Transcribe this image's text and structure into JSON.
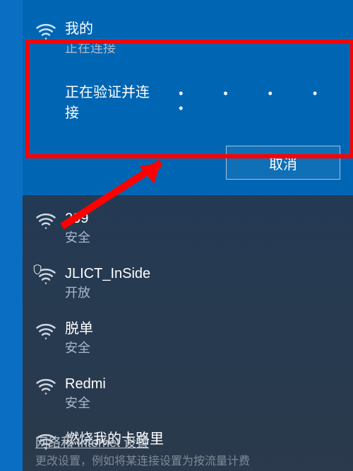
{
  "connecting": {
    "name": "我的",
    "sub": "正在连接",
    "status": "正在验证并连接",
    "cancel": "取消"
  },
  "networks": [
    {
      "name": "209",
      "sub": "安全",
      "shield": false
    },
    {
      "name": "JLICT_InSide",
      "sub": "开放",
      "shield": true
    },
    {
      "name": "脱单",
      "sub": "安全",
      "shield": false
    },
    {
      "name": "Redmi",
      "sub": "安全",
      "shield": false
    },
    {
      "name": "燃烧我的卡路里",
      "sub": "",
      "shield": false
    }
  ],
  "settings_link": "网络和 Internet 设置",
  "settings_sub": "更改设置，例如将某连接设置为按流量计费"
}
